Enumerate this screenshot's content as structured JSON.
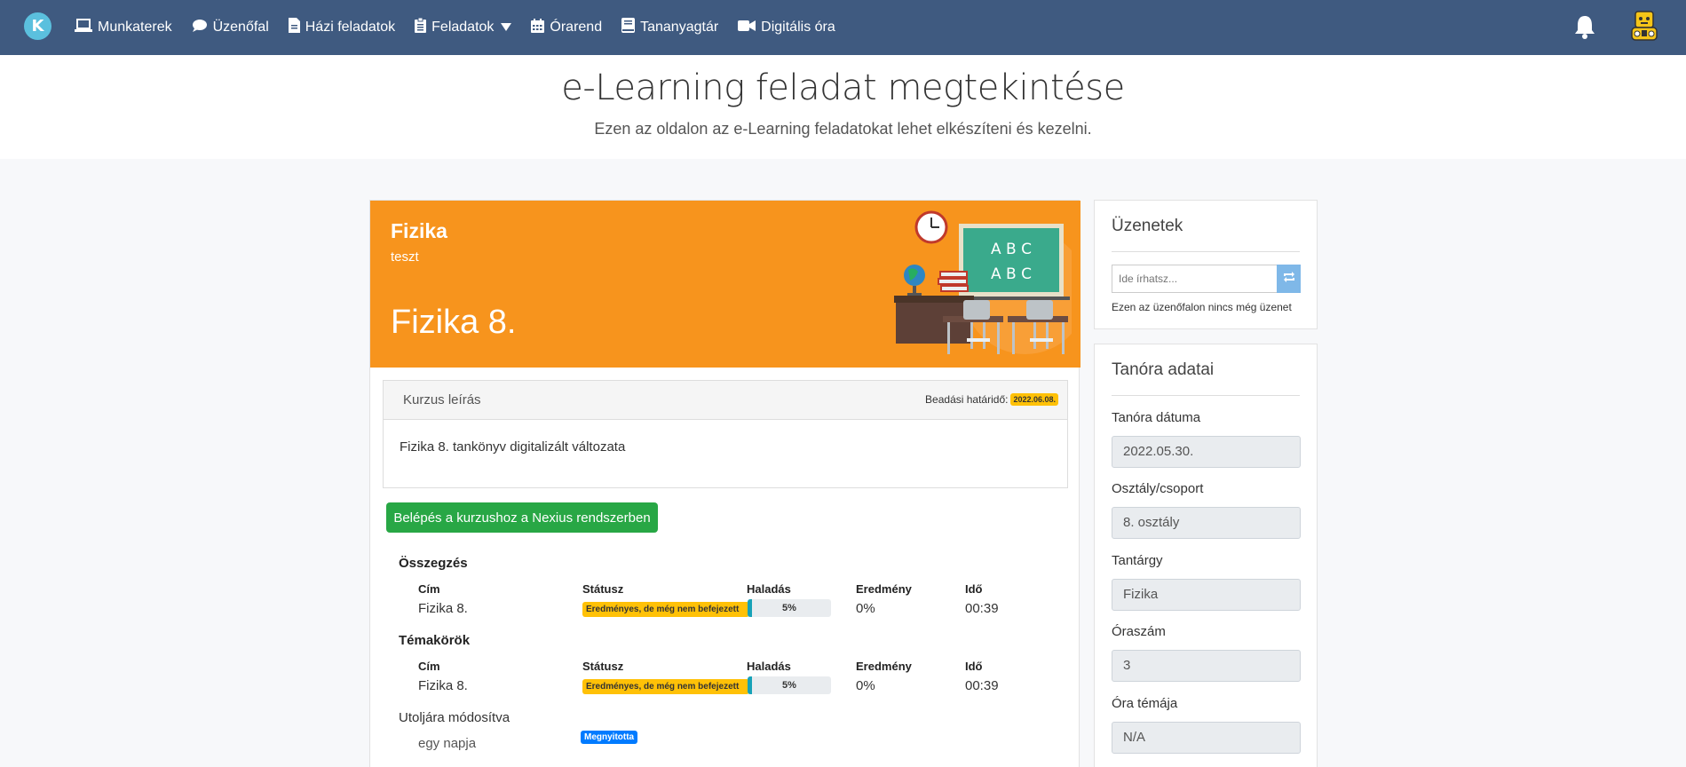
{
  "nav": {
    "items": [
      {
        "label": "Munkaterek",
        "icon": "laptop-icon"
      },
      {
        "label": "Üzenőfal",
        "icon": "chat-icon"
      },
      {
        "label": "Házi feladatok",
        "icon": "file-icon"
      },
      {
        "label": "Feladatok",
        "icon": "clipboard-icon"
      },
      {
        "label": "Órarend",
        "icon": "calendar-icon"
      },
      {
        "label": "Tananyagtár",
        "icon": "book-icon"
      },
      {
        "label": "Digitális óra",
        "icon": "video-icon"
      }
    ]
  },
  "header": {
    "title": "e-Learning feladat megtekintése",
    "subtitle": "Ezen az oldalon az e-Learning feladatokat lehet elkészíteni és kezelni."
  },
  "banner": {
    "subject": "Fizika",
    "sub": "teszt",
    "title": "Fizika 8.",
    "board_lines": [
      "A B C",
      "A B C"
    ]
  },
  "course": {
    "header_label": "Kurzus leírás",
    "deadline_label": "Beadási határidő:",
    "deadline_value": "2022.06.08.",
    "description": "Fizika 8. tankönyv digitalizált változata",
    "nexius_button": "Belépés a kurzushoz a Nexius rendszerben"
  },
  "summary": {
    "title": "Összegzés",
    "columns": [
      "Cím",
      "Státusz",
      "Haladás",
      "Eredmény",
      "Idő"
    ],
    "row": {
      "title": "Fizika 8.",
      "status": "Eredményes, de még nem befejezett",
      "progress_label": "5%",
      "progress_value": 5,
      "result": "0%",
      "time": "00:39"
    }
  },
  "topics": {
    "title": "Témakörök",
    "columns": [
      "Cím",
      "Státusz",
      "Haladás",
      "Eredmény",
      "Idő"
    ],
    "row": {
      "title": "Fizika 8.",
      "status": "Eredményes, de még nem befejezett",
      "progress_label": "5%",
      "progress_value": 5,
      "result": "0%",
      "time": "00:39"
    }
  },
  "modified": {
    "label": "Utoljára módosítva",
    "when": "egy napja",
    "badge": "Megnyitotta"
  },
  "messages": {
    "title": "Üzenetek",
    "placeholder": "Ide írhatsz...",
    "empty": "Ezen az üzenőfalon nincs még üzenet"
  },
  "lesson": {
    "title": "Tanóra adatai",
    "fields": [
      {
        "label": "Tanóra dátuma",
        "value": "2022.05.30."
      },
      {
        "label": "Osztály/csoport",
        "value": "8. osztály"
      },
      {
        "label": "Tantárgy",
        "value": "Fizika"
      },
      {
        "label": "Óraszám",
        "value": "3"
      },
      {
        "label": "Óra témája",
        "value": "N/A"
      }
    ]
  },
  "colors": {
    "navbar": "#3f5a80",
    "banner": "#f7941d",
    "success": "#28a745",
    "warning": "#ffc107",
    "info": "#17a2b8",
    "primary": "#007bff"
  }
}
